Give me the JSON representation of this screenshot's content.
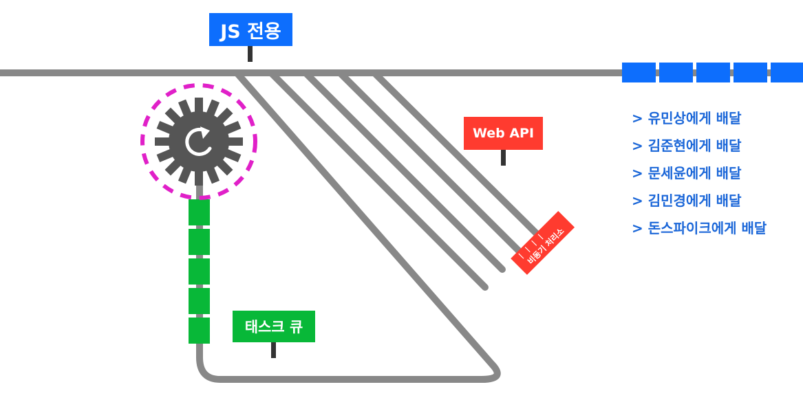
{
  "signs": {
    "js_only": "JS 전용",
    "web_api": "Web API",
    "task_queue": "태스크 큐",
    "async_processor": "비동기 처리소"
  },
  "delivery_list": [
    "> 유민상에게 배달",
    "> 김준현에게 배달",
    "> 문세윤에게 배달",
    "> 김민경에게 배달",
    "> 돈스파이크에게 배달"
  ],
  "icons": {
    "event_loop": "gear-refresh-icon"
  },
  "colors": {
    "track": "#888888",
    "js_blue": "#0d6efd",
    "web_api_red": "#ff3b2f",
    "task_green": "#08b838",
    "event_loop_ring": "#e020c8",
    "gear": "#555555",
    "list_text": "#1a66d8"
  },
  "counts": {
    "queued_blue_blocks": 5,
    "task_queue_blocks": 5,
    "parallel_tracks": 5
  }
}
